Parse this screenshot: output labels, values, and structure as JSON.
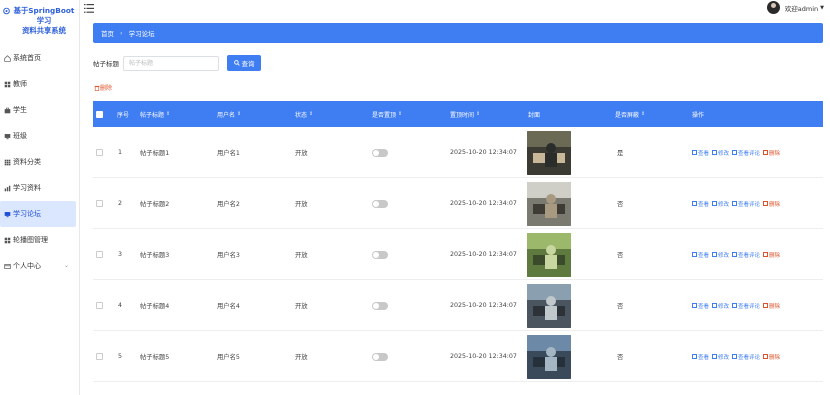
{
  "app": {
    "title_line1": "基于SpringBoot学习",
    "title_line2": "资料共享系统"
  },
  "sidebar": {
    "items": [
      {
        "label": "系统首页",
        "icon": "home-icon"
      },
      {
        "label": "教师",
        "icon": "grid-icon"
      },
      {
        "label": "学生",
        "icon": "bag-icon"
      },
      {
        "label": "班级",
        "icon": "monitor-icon"
      },
      {
        "label": "资料分类",
        "icon": "grid-icon"
      },
      {
        "label": "学习资料",
        "icon": "chart-icon"
      },
      {
        "label": "学习论坛",
        "icon": "monitor-icon",
        "active": true
      },
      {
        "label": "轮播图管理",
        "icon": "grid-icon"
      },
      {
        "label": "个人中心",
        "icon": "card-icon",
        "expandable": true
      }
    ]
  },
  "header": {
    "user_greeting": "欢迎admin"
  },
  "breadcrumb": {
    "home": "首页",
    "current": "学习论坛"
  },
  "search": {
    "label": "帖子标题",
    "placeholder": "帖子标题",
    "button": "查询"
  },
  "actions": {
    "delete_label": "删除"
  },
  "table": {
    "columns": [
      "序号",
      "帖子标题",
      "用户名",
      "状态",
      "是否置顶",
      "置顶时间",
      "封面",
      "是否屏蔽",
      "操作"
    ],
    "row_ops": [
      "查看",
      "修改",
      "查看评论",
      "删除"
    ],
    "rows": [
      {
        "index": "1",
        "title": "帖子标题1",
        "user": "用户名1",
        "status": "开放",
        "top_time": "2025-10-20 12:34:07",
        "blocked": "是"
      },
      {
        "index": "2",
        "title": "帖子标题2",
        "user": "用户名2",
        "status": "开放",
        "top_time": "2025-10-20 12:34:07",
        "blocked": "否"
      },
      {
        "index": "3",
        "title": "帖子标题3",
        "user": "用户名3",
        "status": "开放",
        "top_time": "2025-10-20 12:34:07",
        "blocked": "否"
      },
      {
        "index": "4",
        "title": "帖子标题4",
        "user": "用户名4",
        "status": "开放",
        "top_time": "2025-10-20 12:34:07",
        "blocked": "否"
      },
      {
        "index": "5",
        "title": "帖子标题5",
        "user": "用户名5",
        "status": "开放",
        "top_time": "2025-10-20 12:34:07",
        "blocked": "否"
      }
    ]
  },
  "colors": {
    "accent": "#3f7df2",
    "danger": "#e0532a",
    "active_bg": "#dbe6ff"
  }
}
